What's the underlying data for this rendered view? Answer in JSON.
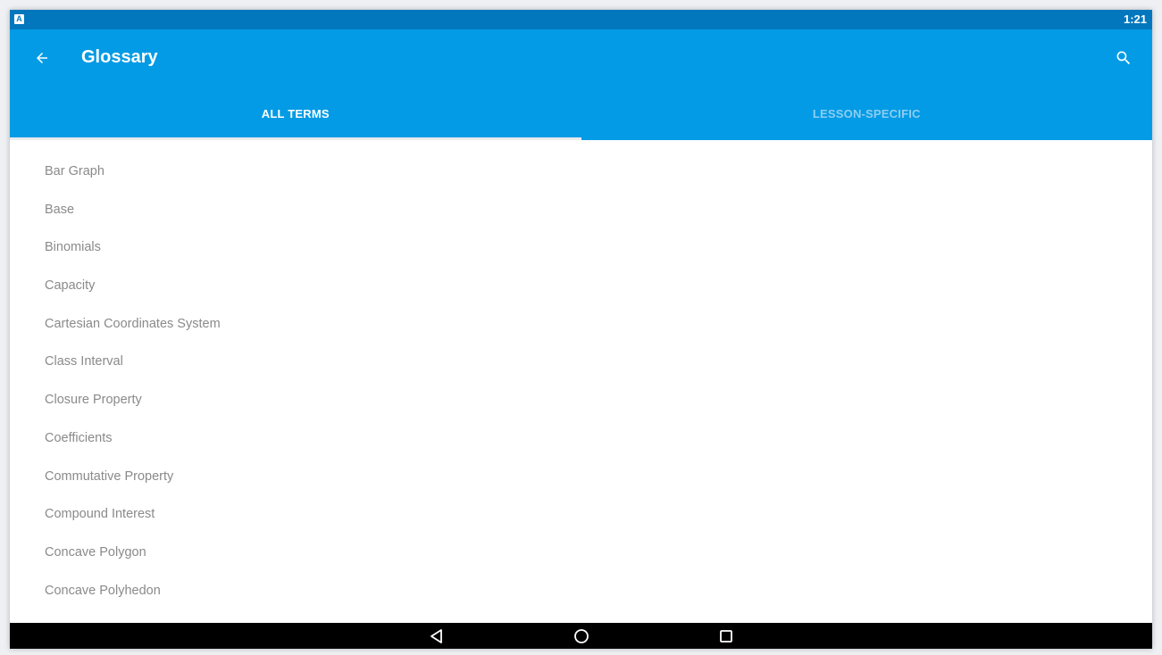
{
  "status_bar": {
    "app_icon_letter": "A",
    "time": "1:21"
  },
  "app_bar": {
    "title": "Glossary",
    "back_icon": "arrow-back-icon",
    "search_icon": "search-icon"
  },
  "tabs": [
    {
      "label": "ALL TERMS",
      "selected": true
    },
    {
      "label": "LESSON-SPECIFIC",
      "selected": false
    }
  ],
  "terms": [
    "Bar Graph",
    "Base",
    "Binomials",
    "Capacity",
    "Cartesian Coordinates System",
    "Class Interval",
    "Closure Property",
    "Coefficients",
    "Commutative Property",
    "Compound Interest",
    "Concave Polygon",
    "Concave Polyhedon"
  ],
  "nav_bar": {
    "back_icon": "nav-back-icon",
    "home_icon": "nav-home-icon",
    "recents_icon": "nav-recents-icon"
  },
  "colors": {
    "status_bar": "#0277bd",
    "app_bar": "#039be5",
    "tab_active": "#ffffff",
    "tab_inactive": "#8ecdf2",
    "term_text": "#8a8a8a"
  }
}
